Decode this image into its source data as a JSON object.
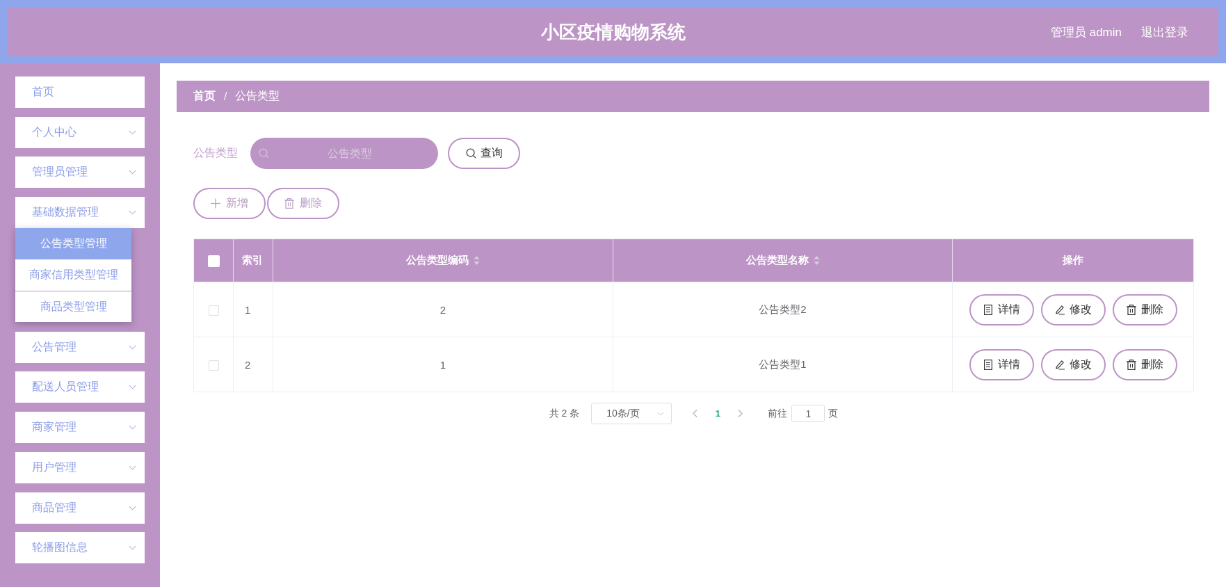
{
  "header": {
    "title": "小区疫情购物系统",
    "user": "管理员 admin",
    "logout": "退出登录"
  },
  "sidebar": {
    "items": [
      {
        "kind": "link",
        "label": "首页"
      },
      {
        "kind": "submenu",
        "label": "个人中心"
      },
      {
        "kind": "submenu",
        "label": "管理员管理"
      },
      {
        "kind": "submenu",
        "label": "基础数据管理",
        "children": [
          {
            "label": "公告类型管理",
            "selected": true
          },
          {
            "label": "商家信用类型管理",
            "selected": false
          },
          {
            "label": "商品类型管理",
            "selected": false
          }
        ]
      },
      {
        "kind": "submenu",
        "label": "公告管理"
      },
      {
        "kind": "submenu",
        "label": "配送人员管理"
      },
      {
        "kind": "submenu",
        "label": "商家管理"
      },
      {
        "kind": "submenu",
        "label": "用户管理"
      },
      {
        "kind": "submenu",
        "label": "商品管理"
      },
      {
        "kind": "submenu",
        "label": "轮播图信息"
      }
    ]
  },
  "breadcrumb": {
    "separator": "/",
    "items": [
      "首页",
      "公告类型"
    ]
  },
  "search": {
    "label": "公告类型",
    "placeholder": "公告类型",
    "button": "查询"
  },
  "toolbar": [
    {
      "kind": "add",
      "label": "新增"
    },
    {
      "kind": "delete",
      "label": "删除"
    }
  ],
  "table": {
    "select_all_checked": false,
    "columns": [
      {
        "kind": "index",
        "label": "索引",
        "sortable": false
      },
      {
        "kind": "text",
        "label": "公告类型编码",
        "sortable": true
      },
      {
        "kind": "text",
        "label": "公告类型名称",
        "sortable": true
      },
      {
        "kind": "actions",
        "label": "操作",
        "sortable": false
      }
    ],
    "rows": [
      {
        "checked": false,
        "cells": [
          "1",
          "2",
          "公告类型2"
        ],
        "actions": [
          {
            "kind": "detail",
            "label": "详情"
          },
          {
            "kind": "edit",
            "label": "修改"
          },
          {
            "kind": "delete",
            "label": "删除"
          }
        ]
      },
      {
        "checked": false,
        "cells": [
          "2",
          "1",
          "公告类型1"
        ],
        "actions": [
          {
            "kind": "detail",
            "label": "详情"
          },
          {
            "kind": "edit",
            "label": "修改"
          },
          {
            "kind": "delete",
            "label": "删除"
          }
        ]
      }
    ]
  },
  "pagination": {
    "total": "共 2 条",
    "page_size": "10条/页",
    "pages": [
      {
        "label": "1",
        "selected": true
      }
    ],
    "goto_label": "前往",
    "goto_value": "1",
    "goto_suffix": "页"
  }
}
